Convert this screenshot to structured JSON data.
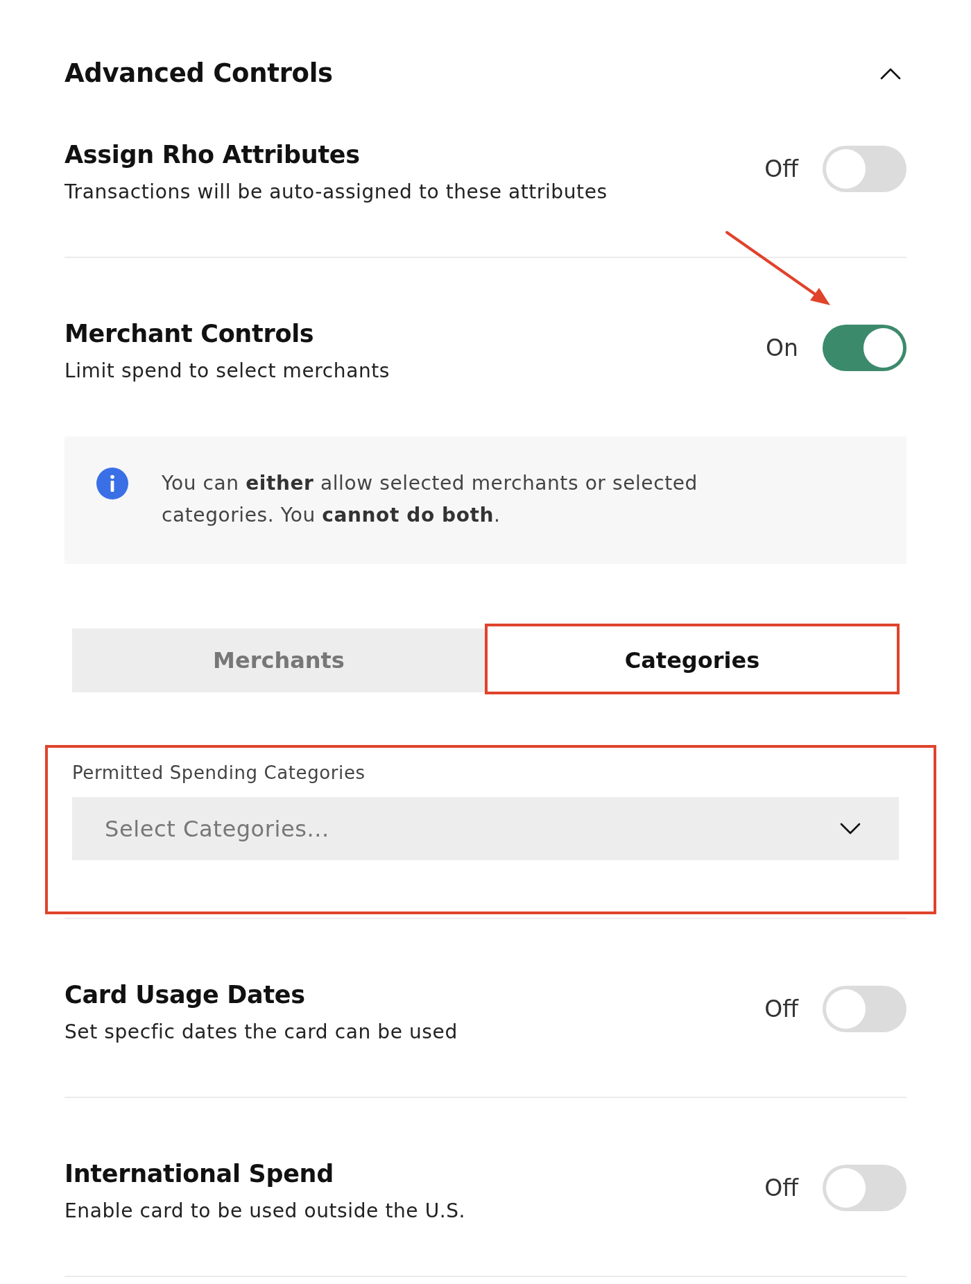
{
  "section": {
    "title": "Advanced Controls",
    "expanded": true
  },
  "settings": [
    {
      "title": "Assign Rho Attributes",
      "description": "Transactions will be auto-assigned to these attributes",
      "state_label": "Off",
      "on": false,
      "annotation_arrow": false
    },
    {
      "title": "Merchant Controls",
      "description": "Limit spend to select merchants",
      "state_label": "On",
      "on": true,
      "annotation_arrow": true,
      "info_note": "You can **either** allow selected merchants or selected categories. You **cannot do both**.",
      "tabs": [
        {
          "label": "Merchants",
          "selected": false,
          "highlighted": false
        },
        {
          "label": "Categories",
          "selected": true,
          "highlighted": true
        }
      ],
      "select": {
        "label": "Permitted Spending Categories",
        "placeholder": "Select Categories...",
        "highlighted": true
      }
    },
    {
      "title": "Card Usage Dates",
      "description": "Set specfic dates the card can be used",
      "state_label": "Off",
      "on": false,
      "annotation_arrow": false
    },
    {
      "title": "International Spend",
      "description": "Enable card to be used outside the U.S.",
      "state_label": "Off",
      "on": false,
      "annotation_arrow": false
    }
  ]
}
